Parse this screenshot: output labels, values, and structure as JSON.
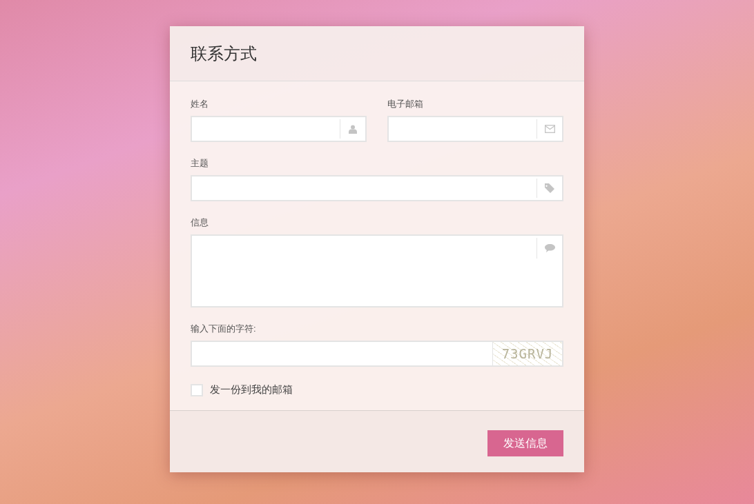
{
  "form": {
    "title": "联系方式",
    "fields": [
      {
        "label": "姓名",
        "kind": "person",
        "wide": false
      },
      {
        "label": "电子邮箱",
        "kind": "envelope",
        "wide": false
      },
      {
        "label": "主题",
        "kind": "tag",
        "wide": true
      },
      {
        "label": "信息",
        "kind": "bubble",
        "wide": true
      },
      {
        "label": "输入下面的字符:",
        "kind": "captcha",
        "wide": true,
        "captcha": "73GRVJ"
      }
    ],
    "copy_to_me": {
      "label": "发一份到我的邮箱",
      "checked": false
    },
    "submit": "发送信息"
  }
}
